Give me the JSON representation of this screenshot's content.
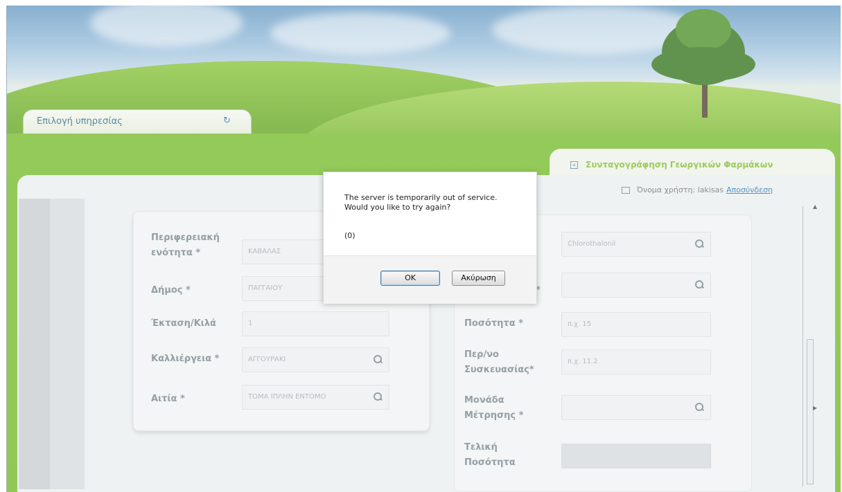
{
  "top_tab": {
    "label": "Επιλογή υπηρεσίας",
    "icon": "refresh-icon"
  },
  "right_tab": {
    "label": "Συνταγογράφηση Γεωργικών Φαρμάκων",
    "icon": "expand-icon"
  },
  "userbar": {
    "label": "Όνομα χρήστη: lakisas",
    "logout": "Αποσύνδεση",
    "icon": "external-link-icon"
  },
  "left_form": {
    "fields": [
      {
        "label_line1": "Περιφερειακή",
        "label_line2": "ενότητα *",
        "value": "ΚΑΒΑΛΑΣ",
        "has_search": false
      },
      {
        "label": "Δήμος *",
        "value": "ΠΑΓΓΑΙΟΥ",
        "has_search": false
      },
      {
        "label": "Έκταση/Κιλά",
        "value": "1",
        "has_search": false
      },
      {
        "label": "Καλλιέργεια *",
        "value": "ΑΓΓΟΥΡΑΚΙ",
        "has_search": true
      },
      {
        "label": "Αιτία *",
        "value": "ΤΟΜΑ ΙΠΛΗΝ ΕΝΤΟΜΟ",
        "has_search": true
      }
    ]
  },
  "right_form": {
    "fields": [
      {
        "label": "",
        "value": "Chlorothalonil",
        "has_search": true
      },
      {
        "label": "*",
        "value": "",
        "has_search": true
      },
      {
        "label": "Ποσότητα *",
        "placeholder": "π.χ. 15"
      },
      {
        "label_line1": "Περ/νο",
        "label_line2": "Συσκευασίας*",
        "placeholder": "π.χ. 11.2"
      },
      {
        "label_line1": "Μονάδα",
        "label_line2": "Μέτρησης *",
        "value": "",
        "has_search": true
      },
      {
        "label_line1": "Τελική",
        "label_line2": "Ποσότητα",
        "value": ""
      }
    ]
  },
  "dialog": {
    "line1": "The server is temporarily out of service.",
    "line2": "Would you like to try again?",
    "code": "(0)",
    "ok_label": "OK",
    "cancel_label": "Ακύρωση"
  },
  "colors": {
    "green": "#7cbf35",
    "link": "#2f7ab3",
    "label_gray": "#7d8a92"
  }
}
